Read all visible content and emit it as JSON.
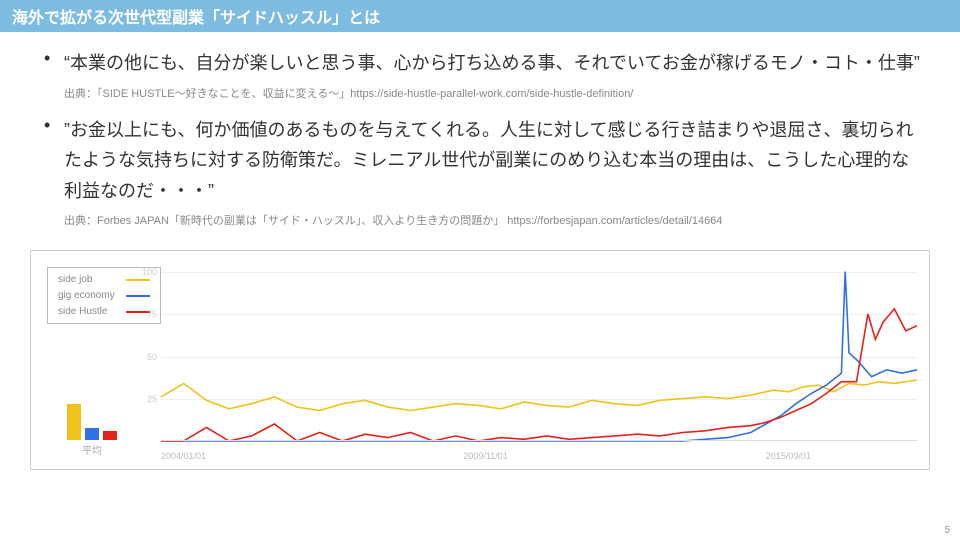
{
  "title": "海外で拡がる次世代型副業「サイドハッスル」とは",
  "bullets": [
    {
      "quote": "“本業の他にも、自分が楽しいと思う事、心から打ち込める事、それでいてお金が稼げるモノ・コト・仕事”",
      "source": "出典：「SIDE HUSTLE～好きなことを、収益に変える～」https://side-hustle-parallel-work.com/side-hustle-definition/"
    },
    {
      "quote": "”お金以上にも、何か価値のあるものを与えてくれる。人生に対して感じる行き詰まりや退屈さ、裏切られたような気持ちに対する防衛策だ。ミレニアル世代が副業にのめり込む本当の理由は、こうした心理的な利益なのだ・・・”",
      "source": "出典：Forbes JAPAN「新時代の副業は「サイド・ハッスル」、収入より生き方の問題か」 https://forbesjapan.com/articles/detail/14664"
    }
  ],
  "page_number": "5",
  "chart_data": {
    "type": "line",
    "title": "",
    "xlabel": "",
    "ylabel": "",
    "ylim": [
      0,
      105
    ],
    "y_ticks": [
      25,
      50,
      75,
      100
    ],
    "x_tick_labels": [
      "2004/01/01",
      "2009/11/01",
      "2015/09/01"
    ],
    "x_tick_positions": [
      0.0,
      0.4,
      0.8
    ],
    "avg_label": "平均",
    "avg_bars": [
      {
        "name": "side job",
        "color": "#F0C31B",
        "value": 30
      },
      {
        "name": "gig economy",
        "color": "#3171E0",
        "value": 10
      },
      {
        "name": "side Hustle",
        "color": "#E2231A",
        "value": 8
      }
    ],
    "series": [
      {
        "name": "side job",
        "color": "#F0C31B",
        "x": [
          0.0,
          0.03,
          0.06,
          0.09,
          0.12,
          0.15,
          0.18,
          0.21,
          0.24,
          0.27,
          0.3,
          0.33,
          0.36,
          0.39,
          0.42,
          0.45,
          0.48,
          0.51,
          0.54,
          0.57,
          0.6,
          0.63,
          0.66,
          0.69,
          0.72,
          0.75,
          0.78,
          0.81,
          0.83,
          0.85,
          0.87,
          0.89,
          0.91,
          0.93,
          0.95,
          0.97,
          1.0
        ],
        "y": [
          26,
          34,
          24,
          19,
          22,
          26,
          20,
          18,
          22,
          24,
          20,
          18,
          20,
          22,
          21,
          19,
          23,
          21,
          20,
          24,
          22,
          21,
          24,
          25,
          26,
          25,
          27,
          30,
          29,
          32,
          33,
          29,
          34,
          33,
          35,
          34,
          36
        ]
      },
      {
        "name": "gig economy",
        "color": "#3171E0",
        "x": [
          0.0,
          0.03,
          0.06,
          0.09,
          0.12,
          0.15,
          0.18,
          0.21,
          0.24,
          0.27,
          0.3,
          0.33,
          0.36,
          0.39,
          0.42,
          0.45,
          0.48,
          0.51,
          0.54,
          0.57,
          0.6,
          0.63,
          0.66,
          0.69,
          0.72,
          0.75,
          0.78,
          0.8,
          0.82,
          0.84,
          0.86,
          0.88,
          0.9,
          0.905,
          0.91,
          0.92,
          0.94,
          0.96,
          0.98,
          1.0
        ],
        "y": [
          0,
          0,
          0,
          0,
          0,
          0,
          0,
          0,
          0,
          0,
          0,
          0,
          0,
          0,
          0,
          0,
          0,
          0,
          0,
          0,
          0,
          0,
          0,
          0,
          1,
          2,
          5,
          10,
          15,
          22,
          28,
          33,
          40,
          100,
          52,
          48,
          38,
          42,
          40,
          42
        ]
      },
      {
        "name": "side Hustle",
        "color": "#E2231A",
        "x": [
          0.0,
          0.03,
          0.06,
          0.09,
          0.12,
          0.15,
          0.18,
          0.21,
          0.24,
          0.27,
          0.3,
          0.33,
          0.36,
          0.39,
          0.42,
          0.45,
          0.48,
          0.51,
          0.54,
          0.57,
          0.6,
          0.63,
          0.66,
          0.69,
          0.72,
          0.75,
          0.78,
          0.8,
          0.82,
          0.84,
          0.86,
          0.88,
          0.9,
          0.92,
          0.935,
          0.945,
          0.955,
          0.97,
          0.985,
          1.0
        ],
        "y": [
          0,
          0,
          8,
          0,
          3,
          10,
          0,
          5,
          0,
          4,
          2,
          5,
          0,
          3,
          0,
          2,
          1,
          3,
          1,
          2,
          3,
          4,
          3,
          5,
          6,
          8,
          9,
          11,
          14,
          18,
          22,
          28,
          35,
          35,
          75,
          60,
          70,
          78,
          65,
          68
        ]
      }
    ]
  }
}
